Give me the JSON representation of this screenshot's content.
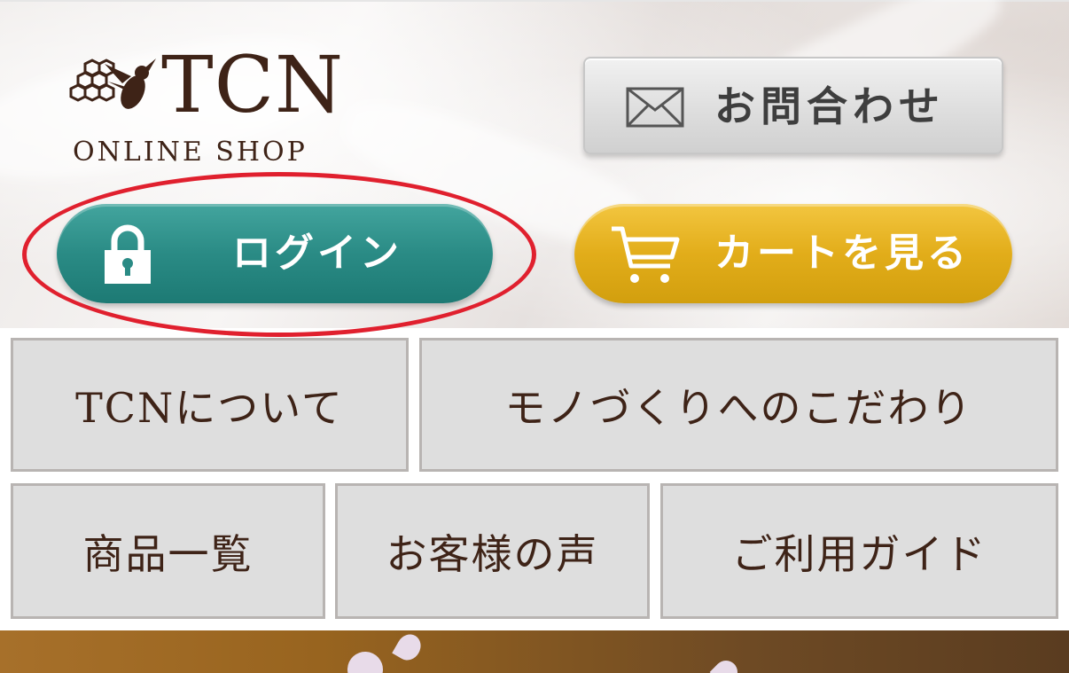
{
  "header": {
    "logo_text": "TCN",
    "logo_subtitle": "ONLINE SHOP",
    "contact_label": "お問合わせ",
    "login_label": "ログイン",
    "cart_label": "カートを見る"
  },
  "nav": {
    "row1": [
      "TCNについて",
      "モノづくりへのこだわり"
    ],
    "row2": [
      "商品一覧",
      "お客様の声",
      "ご利用ガイド"
    ]
  },
  "colors": {
    "brand_brown": "#3e2317",
    "login_teal": "#2a8b85",
    "cart_gold": "#e2ad1a",
    "highlight_red": "#e0202e",
    "tile_bg": "#dedede"
  },
  "icons": {
    "logo": "bee-honeycomb-icon",
    "contact": "envelope-icon",
    "login": "lock-icon",
    "cart": "cart-icon"
  }
}
